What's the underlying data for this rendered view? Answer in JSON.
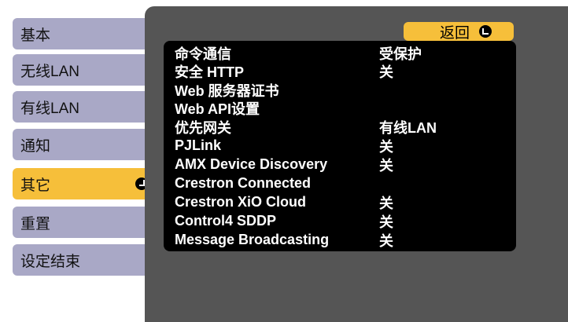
{
  "sidebar": {
    "items": [
      {
        "label": "基本"
      },
      {
        "label": "无线LAN"
      },
      {
        "label": "有线LAN"
      },
      {
        "label": "通知"
      },
      {
        "label": "其它"
      },
      {
        "label": "重置"
      },
      {
        "label": "设定结束"
      }
    ],
    "active_index": 4
  },
  "panel": {
    "back_label": "返回",
    "rows": [
      {
        "label": "命令通信",
        "value": "受保护"
      },
      {
        "label": "安全 HTTP",
        "value": "关"
      },
      {
        "label": "Web 服务器证书",
        "value": ""
      },
      {
        "label": "Web API设置",
        "value": ""
      },
      {
        "label": "优先网关",
        "value": "有线LAN"
      },
      {
        "label": "PJLink",
        "value": "关"
      },
      {
        "label": "AMX Device Discovery",
        "value": "关"
      },
      {
        "label": "Crestron Connected",
        "value": ""
      },
      {
        "label": "Crestron XiO Cloud",
        "value": "关"
      },
      {
        "label": "Control4 SDDP",
        "value": "关"
      },
      {
        "label": "Message Broadcasting",
        "value": "关"
      }
    ]
  },
  "colors": {
    "sidebar_item": "#a9a8c6",
    "active": "#f6bf3a",
    "panel_bg": "#555555",
    "list_bg": "#000000"
  },
  "icons": {
    "enter": "enter-arrow-icon",
    "back": "return-arrow-icon"
  }
}
